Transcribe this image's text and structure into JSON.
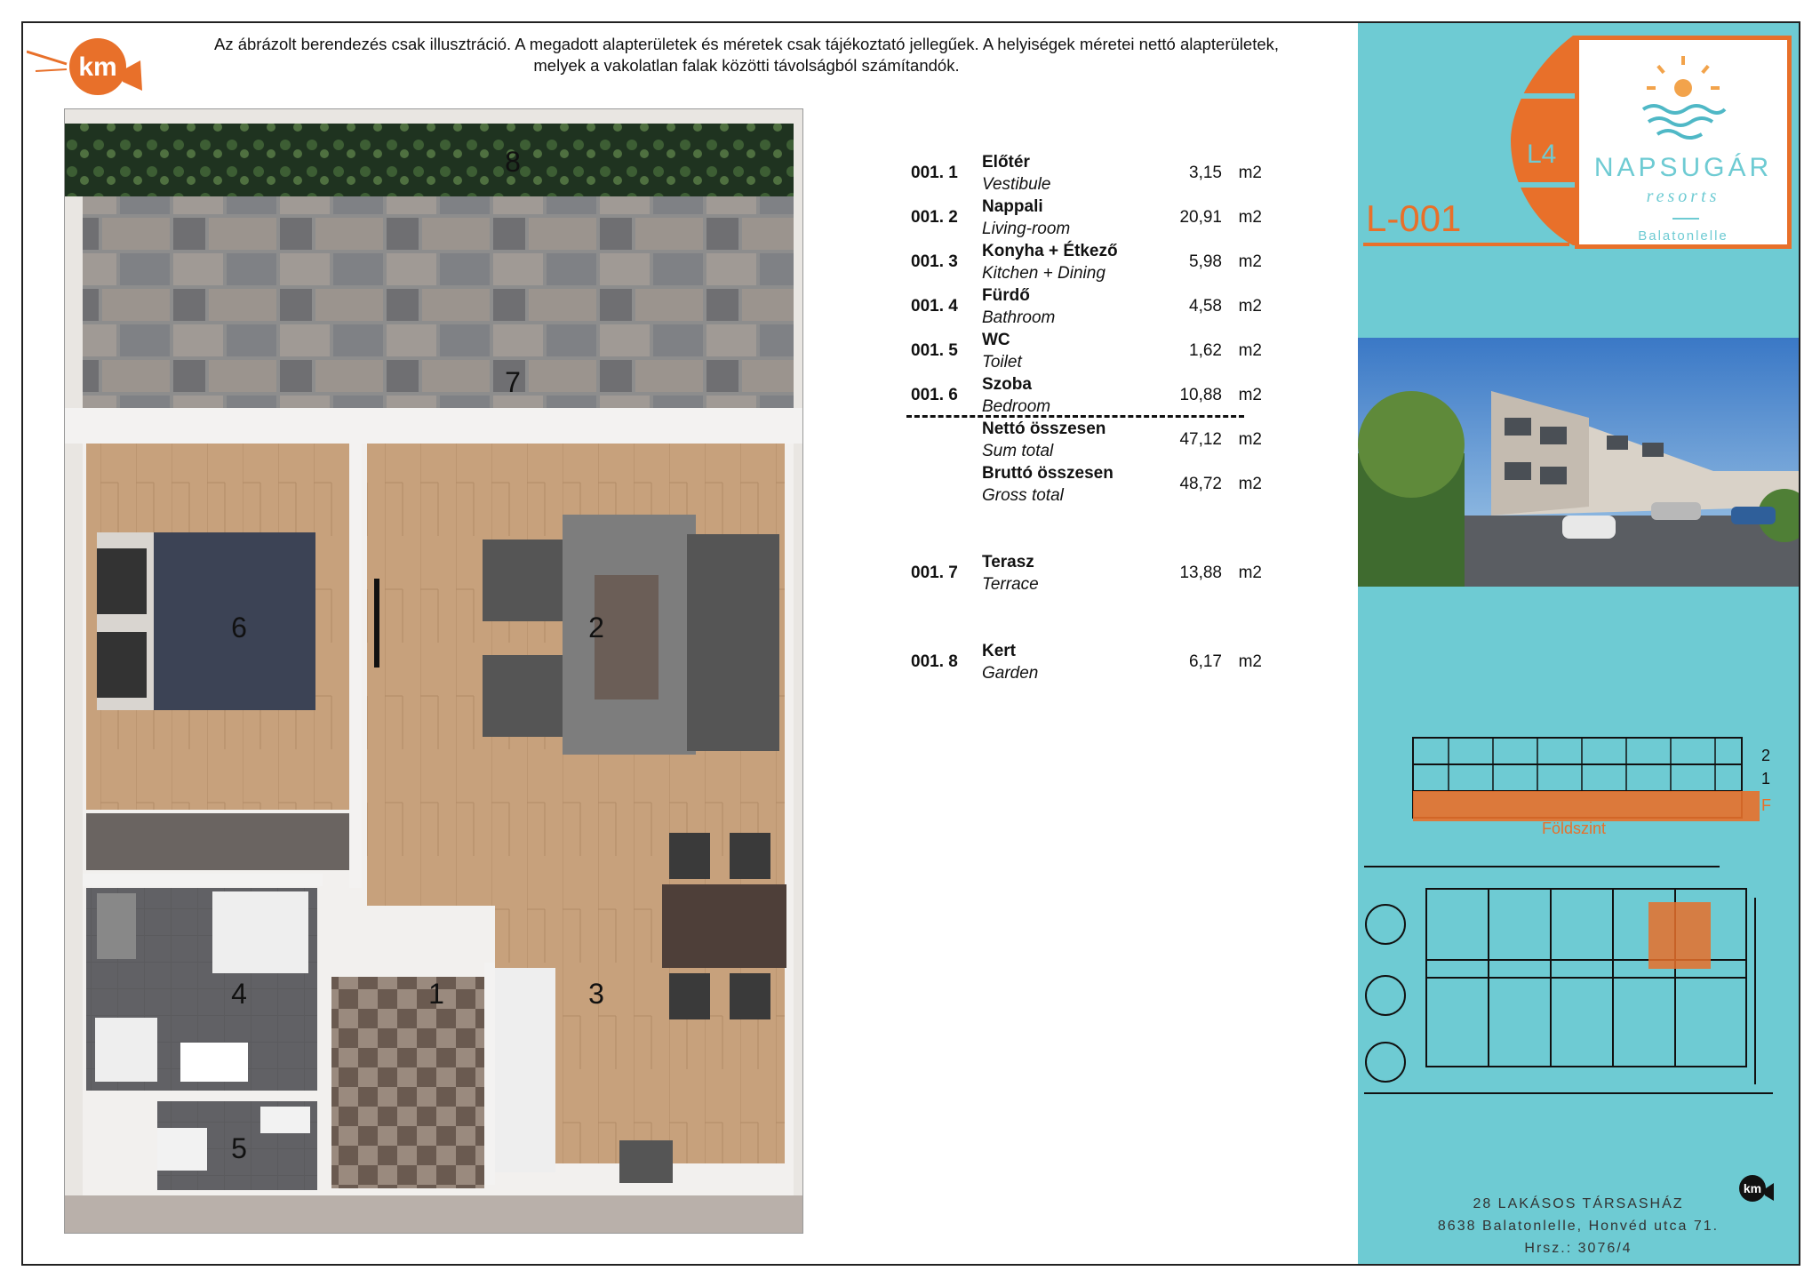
{
  "disclaimer": {
    "line1": "Az ábrázolt berendezés csak illusztráció. A megadott alapterületek és méretek csak tájékoztató jellegűek. A helyiségek méretei nettó alapterületek,",
    "line2": "melyek a vakolatlan falak közötti távolságból számítandók."
  },
  "logo_left": {
    "text": "km",
    "icon": "km-logo-icon"
  },
  "plan": {
    "labels": [
      "8",
      "7",
      "6",
      "2",
      "4",
      "1",
      "3",
      "5"
    ]
  },
  "rooms": [
    {
      "code": "001. 1",
      "hu": "Előtér",
      "en": "Vestibule",
      "area": "3,15",
      "unit": "m2"
    },
    {
      "code": "001. 2",
      "hu": "Nappali",
      "en": "Living-room",
      "area": "20,91",
      "unit": "m2"
    },
    {
      "code": "001. 3",
      "hu": "Konyha + Étkező",
      "en": "Kitchen + Dining",
      "area": "5,98",
      "unit": "m2"
    },
    {
      "code": "001. 4",
      "hu": "Fürdő",
      "en": "Bathroom",
      "area": "4,58",
      "unit": "m2"
    },
    {
      "code": "001. 5",
      "hu": "WC",
      "en": "Toilet",
      "area": "1,62",
      "unit": "m2"
    },
    {
      "code": "001. 6",
      "hu": "Szoba",
      "en": "Bedroom",
      "area": "10,88",
      "unit": "m2"
    }
  ],
  "totals": [
    {
      "hu": "Nettó összesen",
      "en": "Sum total",
      "area": "47,12",
      "unit": "m2"
    },
    {
      "hu": "Bruttó összesen",
      "en": "Gross total",
      "area": "48,72",
      "unit": "m2"
    }
  ],
  "extras": [
    {
      "code": "001. 7",
      "hu": "Terasz",
      "en": "Terrace",
      "area": "13,88",
      "unit": "m2"
    },
    {
      "code": "001. 8",
      "hu": "Kert",
      "en": "Garden",
      "area": "6,17",
      "unit": "m2"
    }
  ],
  "brand": {
    "name": "NAPSUGÁR",
    "sub": "resorts",
    "place": "Balatonlelle",
    "building": "L4",
    "unit_id": "L-001"
  },
  "elevation": {
    "levels": [
      "2",
      "1",
      "F"
    ],
    "ground_label": "Földszint"
  },
  "address": {
    "line1": "28 LAKÁSOS TÁRSASHÁZ",
    "line2": "8638 Balatonlelle, Honvéd utca 71.",
    "line3": "Hrsz.: 3076/4"
  },
  "colors": {
    "accent": "#e8702a",
    "teal": "#6ecbd3",
    "wood": "#c9a27a",
    "stone": "#8a8a8a"
  }
}
